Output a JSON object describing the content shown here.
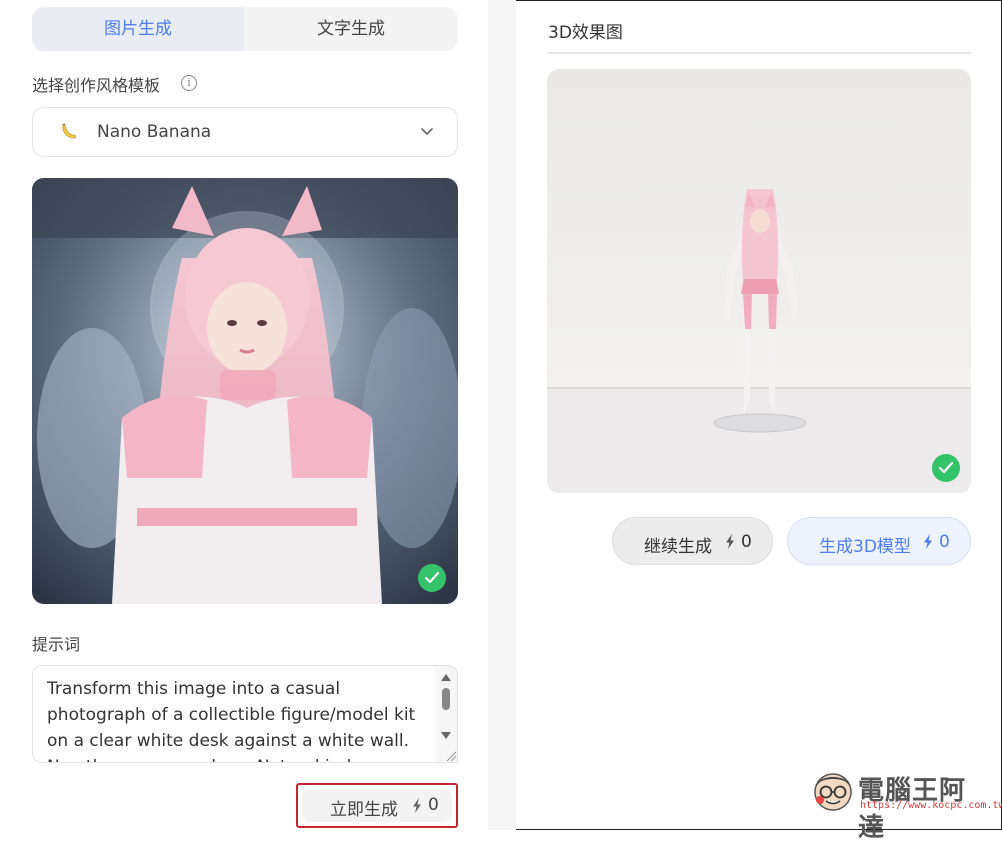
{
  "tabs": [
    {
      "label": "图片生成",
      "active": true
    },
    {
      "label": "文字生成",
      "active": false
    }
  ],
  "style_section": {
    "label": "选择创作风格模板",
    "info_icon": "info-circle-icon",
    "selected_template": "Nano Banana",
    "template_icon": "banana-icon"
  },
  "source_image": {
    "icon": "check-circle-icon",
    "status_color": "#34c26a"
  },
  "prompt": {
    "label": "提示词",
    "value": "Transform this image into a casual photograph of a collectible figure/model kit on a clear white desk against a white wall. No other props or clues. Natural indoor lighting"
  },
  "generate_button": {
    "label": "立即生成",
    "cost": "0",
    "icon": "bolt-icon"
  },
  "result_panel": {
    "title": "3D效果图",
    "status_icon": "check-circle-icon",
    "continue_button": {
      "label": "继续生成",
      "cost": "0"
    },
    "model_button": {
      "label": "生成3D模型",
      "cost": "0"
    }
  },
  "colors": {
    "accent": "#4f7cf0",
    "success": "#34c26a",
    "highlight_border": "#c0262b"
  },
  "watermark": {
    "name": "電腦王阿達",
    "url": "https://www.kocpc.com.tw/"
  }
}
